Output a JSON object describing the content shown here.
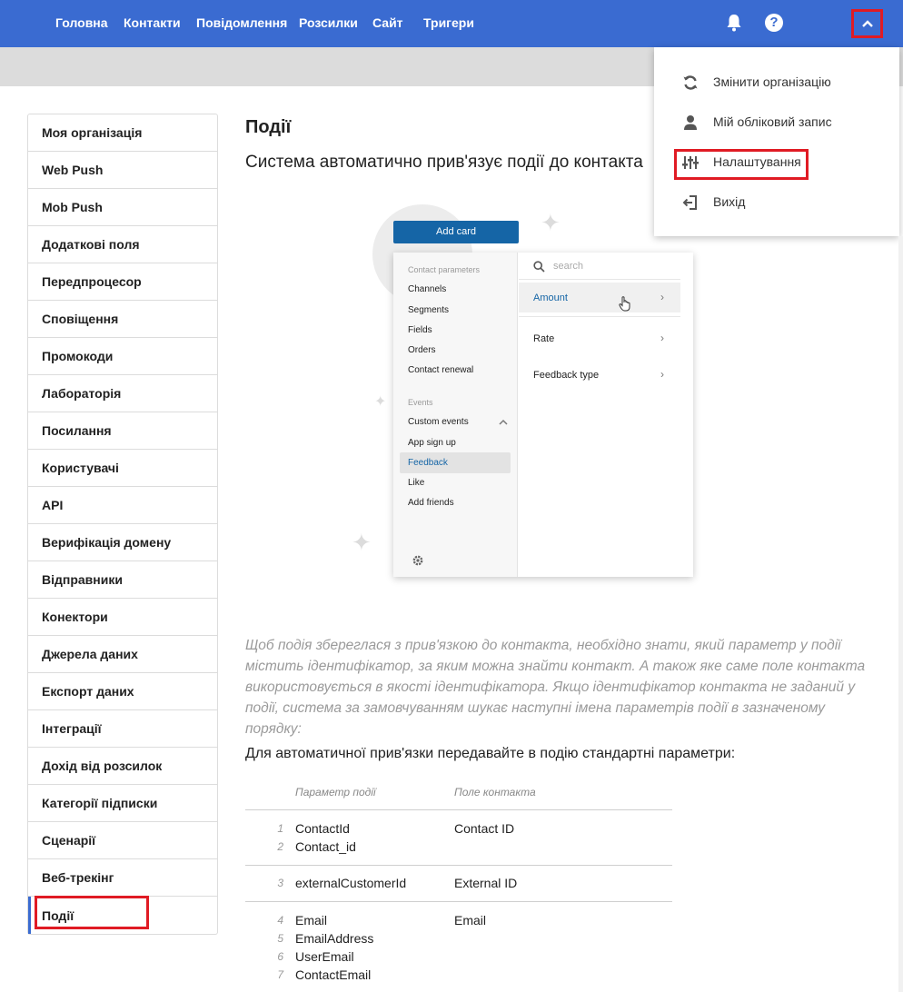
{
  "nav": {
    "items": [
      "Головна",
      "Контакти",
      "Повідомлення",
      "Розсилки",
      "Сайт",
      "Тригери"
    ],
    "help_label": "?"
  },
  "sidebar": {
    "items": [
      {
        "label": "Моя організація"
      },
      {
        "label": "Web Push"
      },
      {
        "label": "Mob Push"
      },
      {
        "label": "Додаткові поля"
      },
      {
        "label": "Передпроцесор"
      },
      {
        "label": "Сповіщення"
      },
      {
        "label": "Промокоди"
      },
      {
        "label": "Лабораторія"
      },
      {
        "label": "Посилання"
      },
      {
        "label": "Користувачі"
      },
      {
        "label": "API"
      },
      {
        "label": "Верифікація домену"
      },
      {
        "label": "Відправники"
      },
      {
        "label": "Конектори"
      },
      {
        "label": "Джерела даних"
      },
      {
        "label": "Експорт даних"
      },
      {
        "label": "Інтеграції"
      },
      {
        "label": "Дохід від розсилок"
      },
      {
        "label": "Категорії підписки"
      },
      {
        "label": "Сценарії"
      },
      {
        "label": "Веб-трекінг"
      },
      {
        "label": "Події"
      }
    ],
    "active_index": 21
  },
  "main": {
    "title": "Події",
    "subtitle": "Система автоматично прив'язує події до контакта",
    "note": "Щоб подія збереглася з прив'язкою до контакта, необхідно знати, який параметр у події містить ідентифікатор, за яким можна знайти контакт. А також яке саме поле контакта використовується в якості ідентифікатора. Якщо ідентифікатор контакта не заданий у події, система за замовчуванням шукає наступні імена параметрів події в зазначеному порядку:",
    "lead": "Для автоматичної прив'язки передавайте в подію стандартні параметри:"
  },
  "illustration": {
    "add_card": "Add card",
    "contact_parameters_header": "Contact parameters",
    "contact_parameters": [
      "Channels",
      "Segments",
      "Fields",
      "Orders",
      "Contact renewal"
    ],
    "events_header": "Events",
    "events": [
      "Custom events",
      "App sign up",
      "Feedback",
      "Like",
      "Add friends"
    ],
    "selected_event": "Feedback",
    "search_placeholder": "search",
    "right_items": [
      "Amount",
      "Rate",
      "Feedback type"
    ],
    "selected_right": "Amount",
    "accent_color": "#1565a6"
  },
  "table": {
    "headers": [
      "Параметр події",
      "Поле контакта"
    ],
    "rows": [
      {
        "params": [
          {
            "n": "1",
            "name": "ContactId"
          },
          {
            "n": "2",
            "name": "Contact_id"
          }
        ],
        "field": "Contact ID"
      },
      {
        "params": [
          {
            "n": "3",
            "name": "externalCustomerId"
          }
        ],
        "field": "External ID"
      },
      {
        "params": [
          {
            "n": "4",
            "name": "Email"
          },
          {
            "n": "5",
            "name": "EmailAddress"
          },
          {
            "n": "6",
            "name": "UserEmail"
          },
          {
            "n": "7",
            "name": "ContactEmail"
          }
        ],
        "field": "Email"
      }
    ]
  },
  "dropdown": {
    "items": [
      {
        "label": "Змінити організацію",
        "icon": "sync-icon"
      },
      {
        "label": "Мій обліковий запис",
        "icon": "person-icon"
      },
      {
        "label": "Налаштування",
        "icon": "sliders-icon"
      },
      {
        "label": "Вихід",
        "icon": "logout-icon"
      }
    ],
    "highlighted": "Налаштування"
  },
  "colors": {
    "nav_bg": "#3a6bd1",
    "highlight": "#e01b24",
    "muted": "#9a9a9a"
  }
}
